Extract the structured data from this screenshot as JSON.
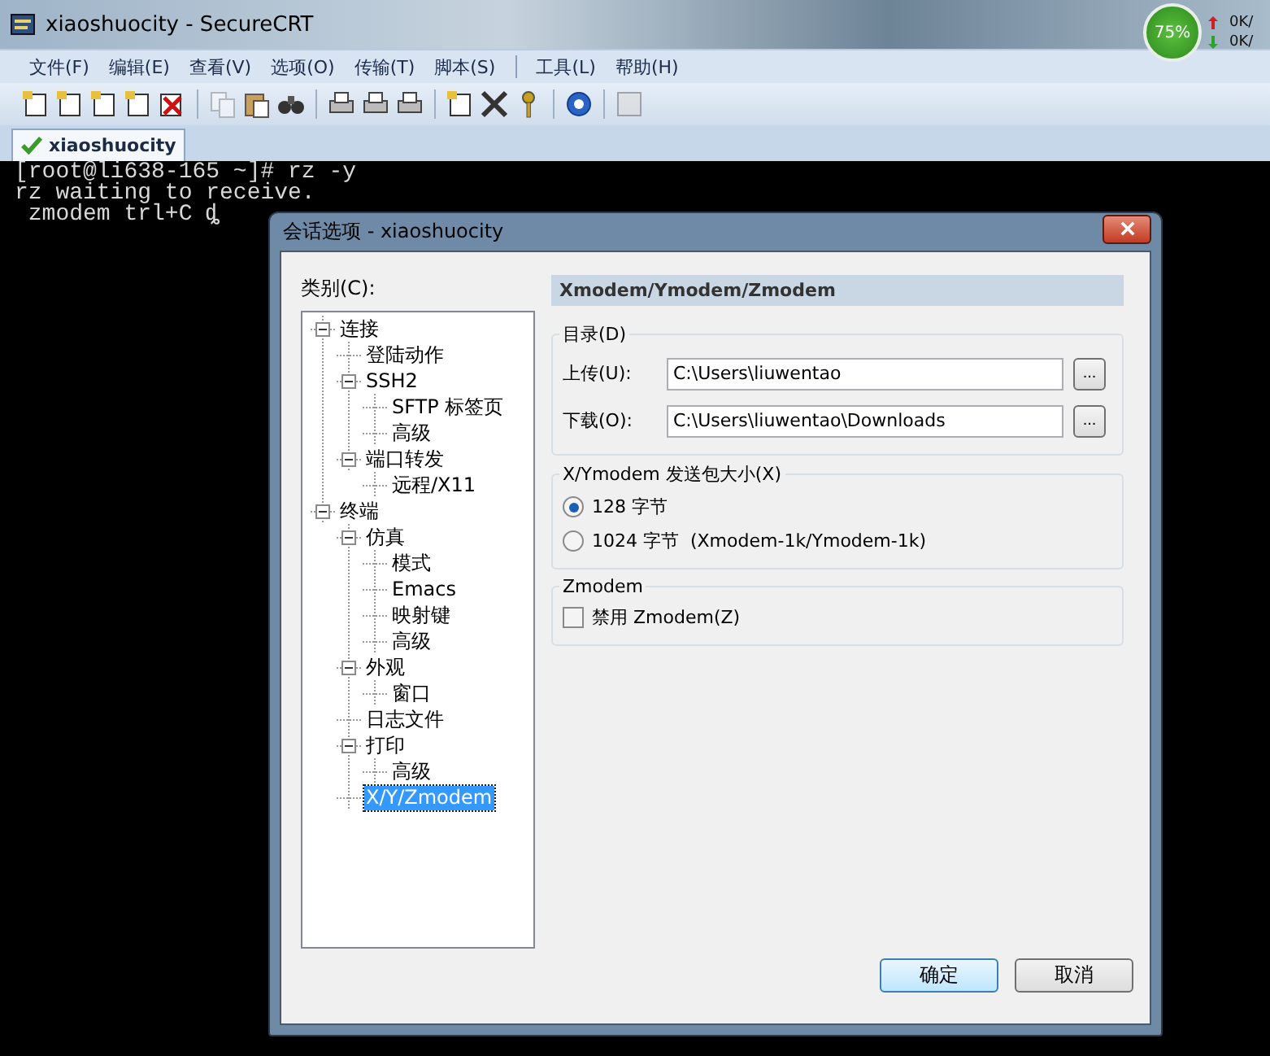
{
  "window": {
    "title": "xiaoshuocity - SecureCRT"
  },
  "menu_groups": [
    [
      "文件(F)",
      "编辑(E)",
      "查看(V)",
      "选项(O)",
      "传输(T)",
      "脚本(S)"
    ],
    [
      "工具(L)",
      "帮助(H)"
    ]
  ],
  "tabs": [
    {
      "label": "xiaoshuocity",
      "selected": true
    }
  ],
  "terminal": {
    "lines": [
      "[root@li638-165 ~]# rz -y",
      "rz waiting to receive.",
      " zmodem trl+C ȡ"
    ]
  },
  "tray_widget": {
    "percent": "75%",
    "up": "0K/",
    "down": "0K/"
  },
  "dialog": {
    "title": "会话选项 - xiaoshuocity",
    "category_label": "类别(C):",
    "tree": [
      {
        "label": "连接",
        "expanded": true,
        "selected": false,
        "children": [
          {
            "label": "登陆动作",
            "selected": false
          },
          {
            "label": "SSH2",
            "expanded": true,
            "selected": false,
            "children": [
              {
                "label": "SFTP 标签页",
                "selected": false
              },
              {
                "label": "高级",
                "selected": false
              }
            ]
          },
          {
            "label": "端口转发",
            "expanded": true,
            "selected": false,
            "children": [
              {
                "label": "远程/X11",
                "selected": false
              }
            ]
          }
        ]
      },
      {
        "label": "终端",
        "expanded": true,
        "selected": false,
        "children": [
          {
            "label": "仿真",
            "expanded": true,
            "selected": false,
            "children": [
              {
                "label": "模式",
                "selected": false
              },
              {
                "label": "Emacs",
                "selected": false
              },
              {
                "label": "映射键",
                "selected": false
              },
              {
                "label": "高级",
                "selected": false
              }
            ]
          },
          {
            "label": "外观",
            "expanded": true,
            "selected": false,
            "children": [
              {
                "label": "窗口",
                "selected": false
              }
            ]
          },
          {
            "label": "日志文件",
            "selected": false
          },
          {
            "label": "打印",
            "expanded": true,
            "selected": false,
            "children": [
              {
                "label": "高级",
                "selected": false
              }
            ]
          },
          {
            "label": "X/Y/Zmodem",
            "selected": true
          }
        ]
      }
    ],
    "panel_title": "Xmodem/Ymodem/Zmodem",
    "directory_group": {
      "legend": "目录(D)",
      "fields": [
        {
          "label": "上传(U):",
          "value": "C:\\Users\\liuwentao",
          "browse": "..."
        },
        {
          "label": "下载(O):",
          "value": "C:\\Users\\liuwentao\\Downloads",
          "browse": "..."
        }
      ]
    },
    "packet_group": {
      "legend": "X/Ymodem 发送包大小(X)",
      "options": [
        {
          "label": "128 字节",
          "selected": true
        },
        {
          "label": "1024 字节  (Xmodem-1k/Ymodem-1k)",
          "selected": false
        }
      ]
    },
    "zmodem_group": {
      "legend": "Zmodem",
      "checkbox": {
        "label": "禁用 Zmodem(Z)",
        "checked": false
      }
    },
    "buttons": [
      {
        "label": "确定",
        "default": true
      },
      {
        "label": "取消",
        "default": false
      }
    ]
  }
}
